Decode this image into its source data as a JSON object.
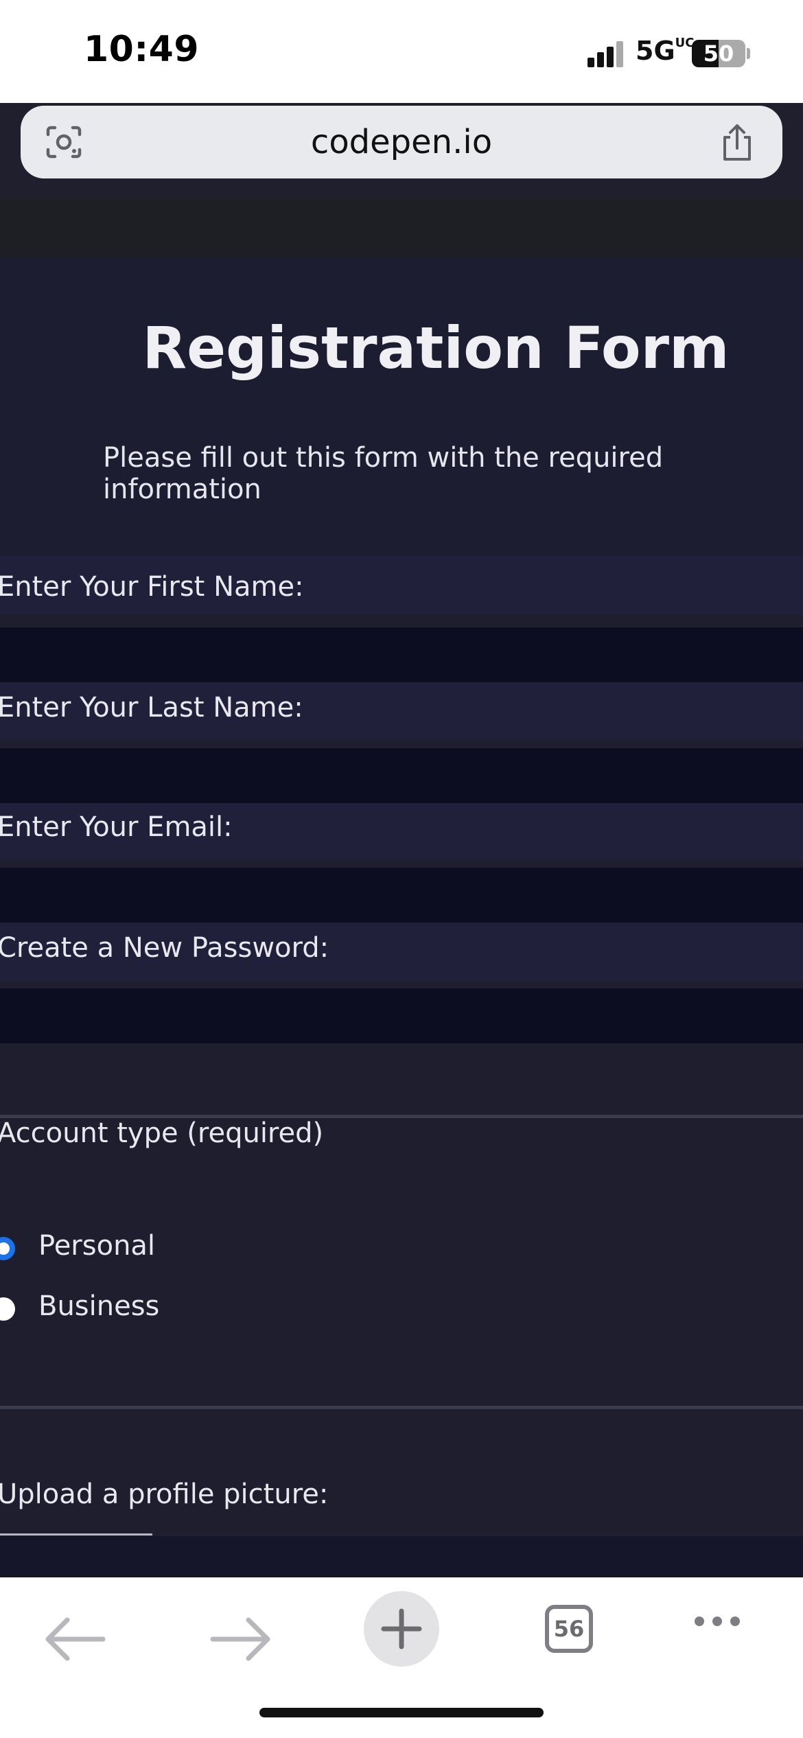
{
  "status_bar": {
    "time": "10:49",
    "network": "5G",
    "network_suffix": "UC",
    "battery": "50",
    "battery_level": 0.5
  },
  "browser": {
    "url": "codepen.io",
    "tabs_count": "56"
  },
  "form": {
    "title": "Registration Form",
    "description": "Please fill out this form with the required information",
    "fields": [
      {
        "label": "Enter Your First Name:",
        "value": ""
      },
      {
        "label": "Enter Your Last Name:",
        "value": ""
      },
      {
        "label": "Enter Your Email:",
        "value": ""
      },
      {
        "label": "Create a New Password:",
        "value": ""
      }
    ],
    "account_type": {
      "label": "Account type (required)",
      "options": [
        {
          "label": "Personal",
          "checked": true
        },
        {
          "label": "Business",
          "checked": false
        }
      ]
    },
    "upload_label": "Upload a profile picture:"
  },
  "colors": {
    "page_bg": "#1e1e2e",
    "input_bg": "#0c0d20",
    "radio_checked": "#1a73e8"
  },
  "icons": {
    "lens": "camera-lens-icon",
    "share": "share-icon",
    "back": "arrow-left-icon",
    "forward": "arrow-right-icon",
    "new_tab": "plus-icon",
    "more": "more-dots-icon"
  }
}
